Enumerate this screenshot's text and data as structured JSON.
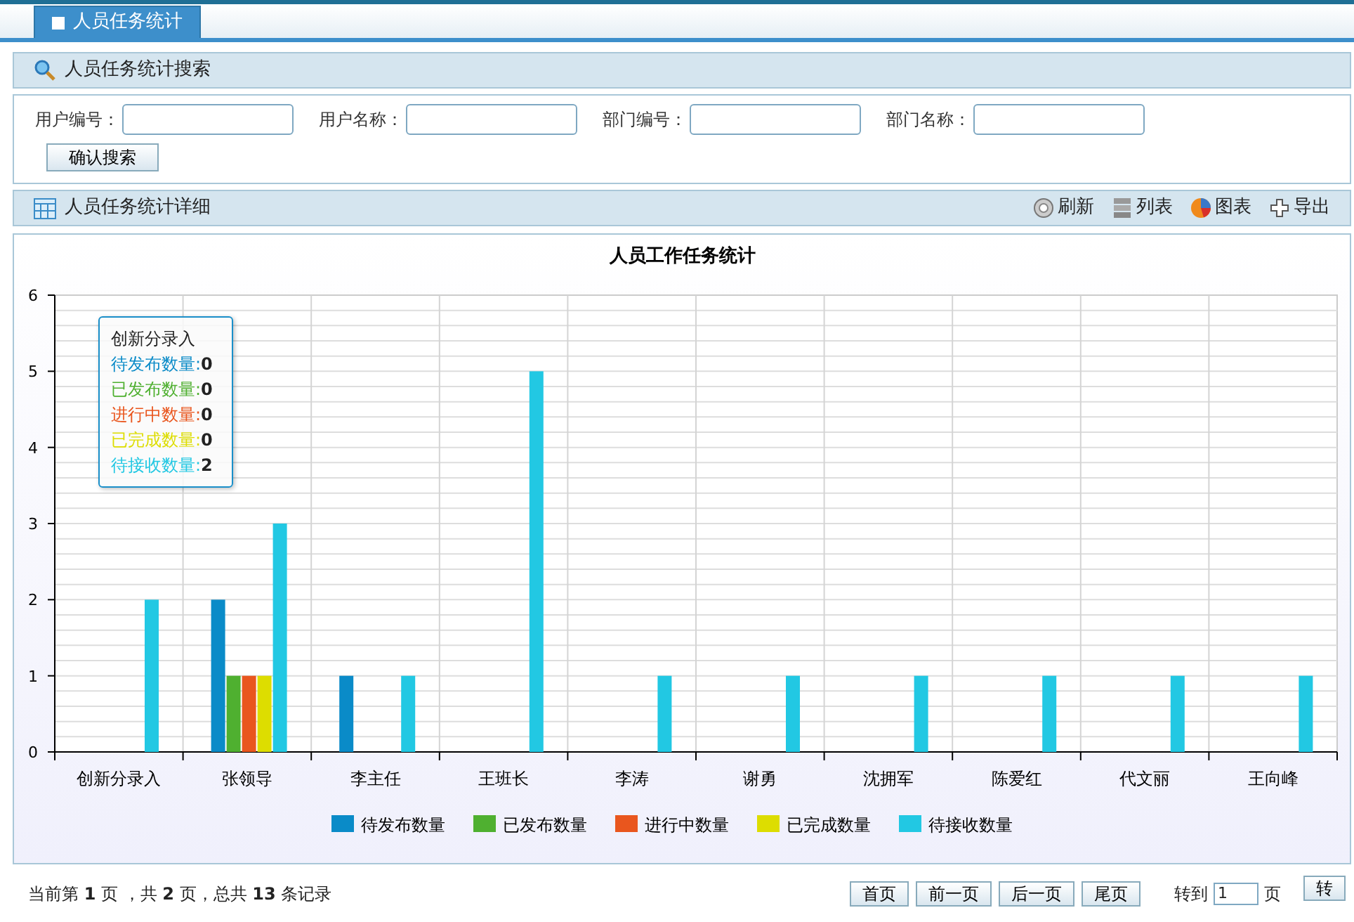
{
  "tabs": [
    {
      "label": "人员任务统计",
      "selected": true
    }
  ],
  "search_panel": {
    "title": "人员任务统计搜索",
    "fields": [
      {
        "label": "用户编号："
      },
      {
        "label": "用户名称："
      },
      {
        "label": "部门编号："
      },
      {
        "label": "部门名称："
      }
    ],
    "button": "确认搜索"
  },
  "detail_panel": {
    "title": "人员任务统计详细",
    "tools": [
      {
        "kind": "refresh",
        "label": "刷新"
      },
      {
        "kind": "list",
        "label": "列表"
      },
      {
        "kind": "chart",
        "label": "图表"
      },
      {
        "kind": "export",
        "label": "导出"
      }
    ]
  },
  "chart": {
    "chart_data": {
      "type": "bar",
      "title": "人员工作任务统计",
      "categories": [
        "创新分录入",
        "张领导",
        "李主任",
        "王班长",
        "李涛",
        "谢勇",
        "沈拥军",
        "陈爱红",
        "代文丽",
        "王向峰"
      ],
      "series": [
        {
          "name": "待发布数量",
          "color": "#0a8bc8",
          "values": [
            0,
            2,
            1,
            0,
            0,
            0,
            0,
            0,
            0,
            0
          ]
        },
        {
          "name": "已发布数量",
          "color": "#4fb030",
          "values": [
            0,
            1,
            0,
            0,
            0,
            0,
            0,
            0,
            0,
            0
          ]
        },
        {
          "name": "进行中数量",
          "color": "#e9561e",
          "values": [
            0,
            1,
            0,
            0,
            0,
            0,
            0,
            0,
            0,
            0
          ]
        },
        {
          "name": "已完成数量",
          "color": "#dddd00",
          "values": [
            0,
            1,
            0,
            0,
            0,
            0,
            0,
            0,
            0,
            0
          ]
        },
        {
          "name": "待接收数量",
          "color": "#22c8e3",
          "values": [
            2,
            3,
            1,
            5,
            1,
            1,
            1,
            1,
            1,
            1
          ]
        }
      ],
      "ylim": [
        0,
        6
      ],
      "yticks": [
        0,
        1,
        2,
        3,
        4,
        5,
        6
      ],
      "grid": true,
      "legend": true
    },
    "tooltip": {
      "title": "创新分录入",
      "rows": [
        {
          "label": "待发布数量:",
          "value": "0"
        },
        {
          "label": "已发布数量:",
          "value": "0"
        },
        {
          "label": "进行中数量:",
          "value": "0"
        },
        {
          "label": "已完成数量:",
          "value": "0"
        },
        {
          "label": "待接收数量:",
          "value": "2"
        }
      ]
    }
  },
  "pager": {
    "summary": "当前第 **1** 页 ，共 **2** 页，总共 **13** 条记录",
    "buttons": [
      "首页",
      "前一页",
      "后一页",
      "尾页"
    ],
    "goto_label": "转到",
    "page_value": "1",
    "page_unit": "页",
    "go_button": "转"
  }
}
